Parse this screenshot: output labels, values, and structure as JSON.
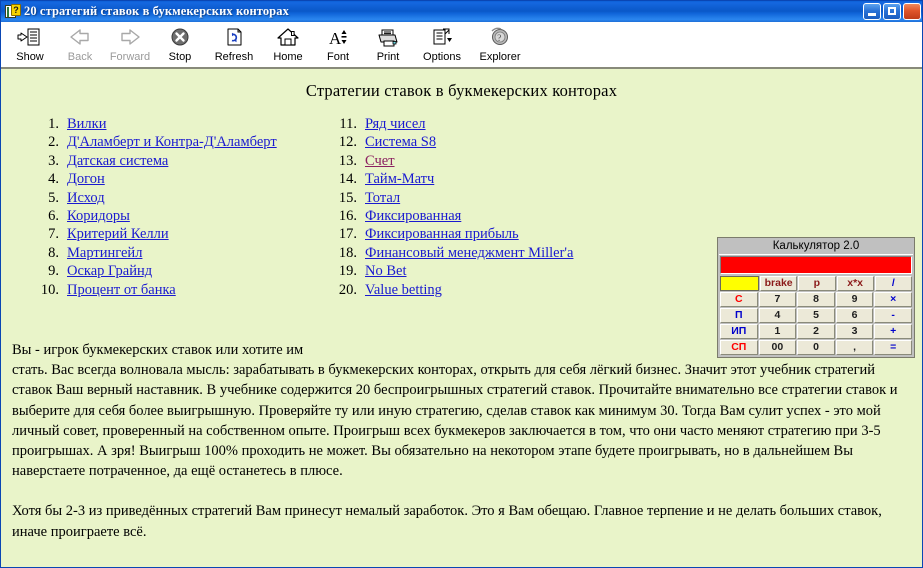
{
  "window": {
    "title": "20 стратегий ставок в букмекерских конторах",
    "icon": "help-book-icon",
    "question_mark": "?",
    "buttons": {
      "minimize": "minimize-button",
      "maximize": "maximize-button",
      "close": "close-button"
    }
  },
  "toolbar": {
    "items": [
      {
        "label": "Show",
        "icon": "show-pane-icon",
        "disabled": false
      },
      {
        "label": "Back",
        "icon": "back-arrow-icon",
        "disabled": true
      },
      {
        "label": "Forward",
        "icon": "forward-arrow-icon",
        "disabled": true
      },
      {
        "label": "Stop",
        "icon": "stop-icon",
        "disabled": false
      },
      {
        "label": "Refresh",
        "icon": "refresh-icon",
        "disabled": false
      },
      {
        "label": "Home",
        "icon": "home-icon",
        "disabled": false
      },
      {
        "label": "Font",
        "icon": "font-icon",
        "disabled": false
      },
      {
        "label": "Print",
        "icon": "print-icon",
        "disabled": false
      },
      {
        "label": "Options",
        "icon": "options-icon",
        "disabled": false
      },
      {
        "label": "Explorer",
        "icon": "explorer-icon",
        "disabled": false
      }
    ]
  },
  "page": {
    "heading": "Стратегии ставок в букмекерских конторах",
    "background_color": "#e9f4c9",
    "link_color": "#1a1ad0",
    "visited_link_color": "#8b2060",
    "list_left": [
      {
        "num": "1.",
        "label": "Вилки",
        "visited": false
      },
      {
        "num": "2.",
        "label": "Д'Аламберт и Контра-Д'Аламберт",
        "visited": false
      },
      {
        "num": "3.",
        "label": "Датская система",
        "visited": false
      },
      {
        "num": "4.",
        "label": "Догон",
        "visited": false
      },
      {
        "num": "5.",
        "label": "Исход",
        "visited": false
      },
      {
        "num": "6.",
        "label": "Коридоры",
        "visited": false
      },
      {
        "num": "7.",
        "label": "Критерий Келли",
        "visited": false
      },
      {
        "num": "8.",
        "label": "Мартингейл",
        "visited": false
      },
      {
        "num": "9.",
        "label": "Оскар Грайнд",
        "visited": false
      },
      {
        "num": "10.",
        "label": "Процент от банка",
        "visited": false
      }
    ],
    "list_right": [
      {
        "num": "11.",
        "label": "Ряд чисел",
        "visited": false
      },
      {
        "num": "12.",
        "label": "Система S8",
        "visited": false
      },
      {
        "num": "13.",
        "label": "Счет",
        "visited": true
      },
      {
        "num": "14.",
        "label": "Тайм-Матч",
        "visited": false
      },
      {
        "num": "15.",
        "label": "Тотал",
        "visited": false
      },
      {
        "num": "16.",
        "label": "Фиксированная",
        "visited": false
      },
      {
        "num": "17.",
        "label": "Фиксированная прибыль",
        "visited": false
      },
      {
        "num": "18.",
        "label": "Финансовый менеджмент Miller'a",
        "visited": false
      },
      {
        "num": "19.",
        "label": "No Bet",
        "visited": false
      },
      {
        "num": "20.",
        "label": "Value betting",
        "visited": false
      }
    ],
    "paragraphs": [
      "Вы - игрок букмекерских ставок или хотите им\nстать. Вас всегда волновала мысль: зарабатывать в букмекерских конторах, открыть для себя лёгкий бизнес. Значит этот учебник стратегий ставок Ваш верный наставник. В учебнике содержится 20 беспроигрышных стратегий ставок. Прочитайте внимательно все стратегии ставок и выберите для себя более выигрышную. Проверяйте ту или иную стратегию, сделав ставок как минимум 30. Тогда Вам сулит успех - это мой личный совет, проверенный на собственном опыте. Проигрыш всех букмекеров заключается в том, что они часто меняют стратегию при 3-5 проигрышах. А зря! Выигрыш 100% проходить не может. Вы обязательно на некотором этапе будете проигрывать, но в дальнейшем Вы наверстаете потраченное, да ещё останетесь в плюсе.",
      "Хотя бы 2-3 из приведённых стратегий Вам принесут немалый заработок. Это я Вам обещаю. Главное терпение и не делать больших ставок, иначе проиграете всё."
    ]
  },
  "calculator": {
    "title": "Калькулятор 2.0",
    "display_color": "#ff0000",
    "display_value": "",
    "entry_value": "",
    "entry_color": "#ffff00",
    "rows": [
      [
        {
          "label": "",
          "style": "entry",
          "name": "calc-entry-field"
        },
        {
          "label": "brake",
          "style": "dark-red",
          "name": "calc-brake-key"
        },
        {
          "label": "p",
          "style": "dark-red",
          "name": "calc-p-key"
        },
        {
          "label": "x*x",
          "style": "dark-red",
          "name": "calc-square-key"
        },
        {
          "label": "/",
          "style": "blue",
          "name": "calc-divide-key"
        }
      ],
      [
        {
          "label": "С",
          "style": "red",
          "name": "calc-clear-key"
        },
        {
          "label": "7",
          "style": "",
          "name": "calc-7-key"
        },
        {
          "label": "8",
          "style": "",
          "name": "calc-8-key"
        },
        {
          "label": "9",
          "style": "",
          "name": "calc-9-key"
        },
        {
          "label": "×",
          "style": "blue",
          "name": "calc-multiply-key"
        }
      ],
      [
        {
          "label": "П",
          "style": "blue",
          "name": "calc-memory-store-key"
        },
        {
          "label": "4",
          "style": "",
          "name": "calc-4-key"
        },
        {
          "label": "5",
          "style": "",
          "name": "calc-5-key"
        },
        {
          "label": "6",
          "style": "",
          "name": "calc-6-key"
        },
        {
          "label": "-",
          "style": "blue",
          "name": "calc-minus-key"
        }
      ],
      [
        {
          "label": "ИП",
          "style": "blue",
          "name": "calc-memory-recall-key"
        },
        {
          "label": "1",
          "style": "",
          "name": "calc-1-key"
        },
        {
          "label": "2",
          "style": "",
          "name": "calc-2-key"
        },
        {
          "label": "3",
          "style": "",
          "name": "calc-3-key"
        },
        {
          "label": "+",
          "style": "blue",
          "name": "calc-plus-key"
        }
      ],
      [
        {
          "label": "СП",
          "style": "red",
          "name": "calc-memory-clear-key"
        },
        {
          "label": "00",
          "style": "",
          "name": "calc-double-zero-key"
        },
        {
          "label": "0",
          "style": "",
          "name": "calc-0-key"
        },
        {
          "label": ",",
          "style": "",
          "name": "calc-decimal-key"
        },
        {
          "label": "=",
          "style": "blue",
          "name": "calc-equals-key"
        }
      ]
    ]
  }
}
